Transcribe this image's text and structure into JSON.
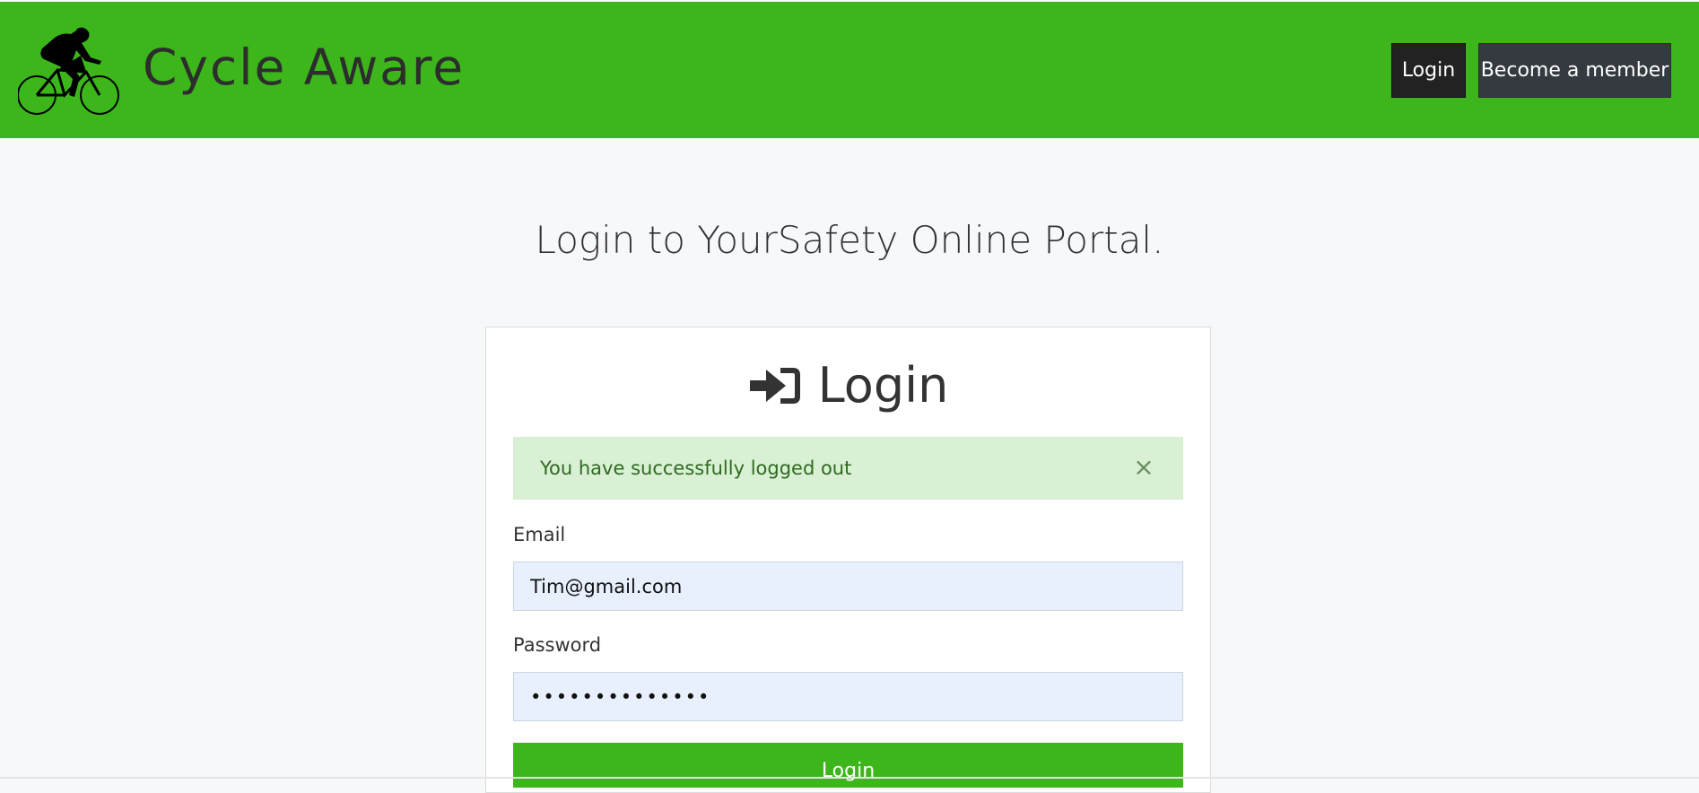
{
  "header": {
    "brand": "Cycle Aware",
    "logo_icon": "cyclist-icon",
    "nav": {
      "login_label": "Login",
      "member_label": "Become a member"
    },
    "colors": {
      "bar": "#3cb61b",
      "login_button": "#222222",
      "member_button": "#343a40"
    }
  },
  "main": {
    "heading": "Login to YourSafety Online Portal.",
    "card": {
      "title_icon": "sign-in-icon",
      "title": "Login",
      "alert": {
        "message": "You have successfully logged out",
        "close_glyph": "×"
      },
      "email": {
        "label": "Email",
        "value": "Tim@gmail.com"
      },
      "password": {
        "label": "Password",
        "value": "••••••••••••••"
      },
      "submit_label": "Login"
    }
  }
}
